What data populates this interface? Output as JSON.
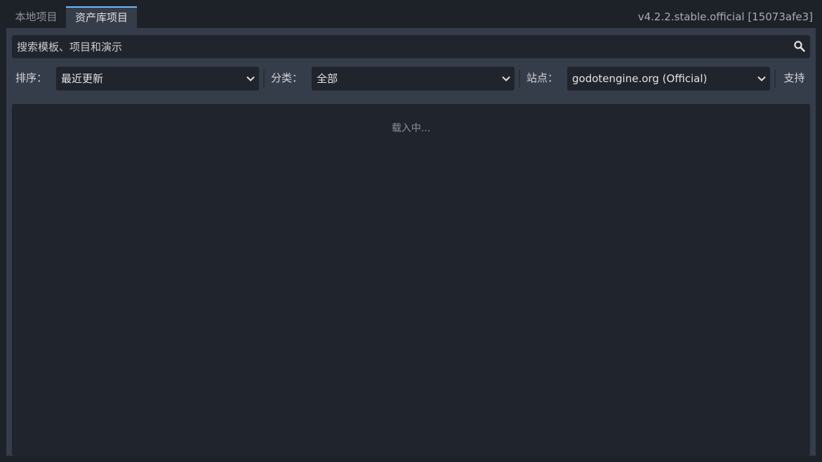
{
  "tabs": {
    "local_label": "本地项目",
    "assetlib_label": "资产库项目"
  },
  "version": "v4.2.2.stable.official [15073afe3]",
  "search": {
    "placeholder": "搜索模板、项目和演示",
    "icon": "search-icon"
  },
  "filters": {
    "sort_label": "排序：",
    "sort_value": "最近更新",
    "category_label": "分类：",
    "category_value": "全部",
    "site_label": "站点：",
    "site_value": "godotengine.org (Official)",
    "support_label": "支持"
  },
  "results": {
    "loading_text": "载入中..."
  },
  "colors": {
    "background": "#1d2229",
    "panel": "#363d4a",
    "field": "#20242c",
    "accent": "#70bafa"
  }
}
